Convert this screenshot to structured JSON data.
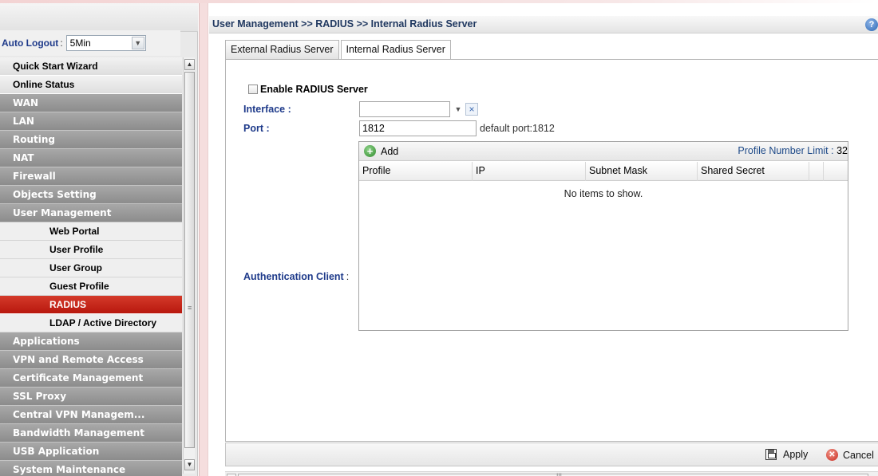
{
  "sidebar": {
    "auto_logout_label": "Auto Logout",
    "auto_logout_colon": ":",
    "auto_logout_value": "5Min",
    "menu": [
      {
        "label": "Quick Start Wizard",
        "style": "white"
      },
      {
        "label": "Online Status",
        "style": "white"
      },
      {
        "label": "WAN",
        "style": "grey"
      },
      {
        "label": "LAN",
        "style": "grey"
      },
      {
        "label": "Routing",
        "style": "grey"
      },
      {
        "label": "NAT",
        "style": "grey"
      },
      {
        "label": "Firewall",
        "style": "grey"
      },
      {
        "label": "Objects Setting",
        "style": "grey"
      },
      {
        "label": "User Management",
        "style": "grey"
      },
      {
        "label": "Web Portal",
        "style": "sub"
      },
      {
        "label": "User Profile",
        "style": "sub"
      },
      {
        "label": "User Group",
        "style": "sub"
      },
      {
        "label": "Guest Profile",
        "style": "sub"
      },
      {
        "label": "RADIUS",
        "style": "active"
      },
      {
        "label": "LDAP / Active Directory",
        "style": "sub"
      },
      {
        "label": "Applications",
        "style": "grey"
      },
      {
        "label": "VPN and Remote Access",
        "style": "grey"
      },
      {
        "label": "Certificate Management",
        "style": "grey"
      },
      {
        "label": "SSL Proxy",
        "style": "grey"
      },
      {
        "label": "Central VPN Managem...",
        "style": "grey"
      },
      {
        "label": "Bandwidth Management",
        "style": "grey"
      },
      {
        "label": "USB Application",
        "style": "grey"
      },
      {
        "label": "System Maintenance",
        "style": "grey"
      }
    ]
  },
  "header": {
    "breadcrumb": "User Management >> RADIUS >> Internal Radius Server",
    "help_icon": "?"
  },
  "tabs": [
    {
      "label": "External Radius Server",
      "active": false
    },
    {
      "label": "Internal Radius Server",
      "active": true
    }
  ],
  "form": {
    "enable_label": "Enable RADIUS Server",
    "enable_checked": false,
    "interface_label": "Interface :",
    "interface_value": "",
    "port_label": "Port :",
    "port_value": "1812",
    "port_hint": "default port:1812",
    "auth_client_label": "Authentication Client",
    "auth_client_colon": ":"
  },
  "grid": {
    "add_label": "Add",
    "limit_label": "Profile Number Limit :",
    "limit_value": "32",
    "columns": [
      "Profile",
      "IP",
      "Subnet Mask",
      "Shared Secret"
    ],
    "empty_text": "No items to show."
  },
  "footer": {
    "apply_label": "Apply",
    "cancel_label": "Cancel"
  }
}
